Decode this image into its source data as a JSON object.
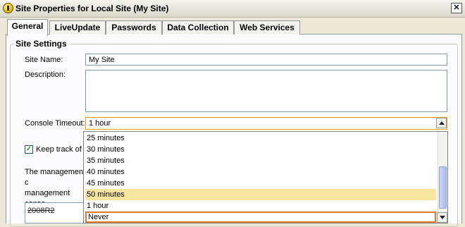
{
  "window": {
    "title": "Site Properties for Local Site (My Site)",
    "close_label": "✕"
  },
  "tabs": [
    "General",
    "LiveUpdate",
    "Passwords",
    "Data Collection",
    "Web Services"
  ],
  "group": {
    "title": "Site Settings"
  },
  "site_name": {
    "label": "Site Name:",
    "value": "My Site"
  },
  "description": {
    "label": "Description:",
    "value": ""
  },
  "console_timeout": {
    "label": "Console Timeout:",
    "selected": "1 hour",
    "options": [
      "25 minutes",
      "30 minutes",
      "35 minutes",
      "40 minutes",
      "45 minutes",
      "50 minutes",
      "1 hour",
      "Never"
    ],
    "highlighted": "50 minutes",
    "focused": "Never"
  },
  "keep_track": {
    "label": "Keep track of e",
    "checked": true
  },
  "management_text": "The management c\nmanagement conso\nbuttons.",
  "bottom_field": {
    "value": "2008R2"
  }
}
